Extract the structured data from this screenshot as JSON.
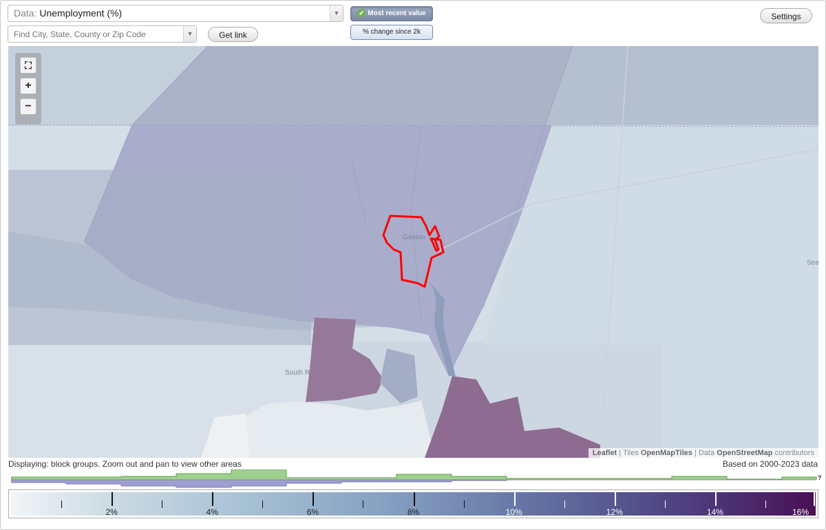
{
  "data_select": {
    "prefix": "Data:",
    "value": "Unemployment (%)"
  },
  "search": {
    "placeholder": "Find City, State, County or Zip Code"
  },
  "buttons": {
    "get_link": "Get link",
    "settings": "Settings"
  },
  "mode_toggle": {
    "active": "Most recent value",
    "inactive": "% change since 2k"
  },
  "zoom": {
    "fullscreen": "⛶",
    "zoom_in": "+",
    "zoom_out": "−"
  },
  "map_labels": {
    "city": "Gaston",
    "town": "South Ro",
    "edge": "Sea"
  },
  "attribution": {
    "leaflet": "Leaflet",
    "tiles_prefix": "| Tiles",
    "tiles": "OpenMapTiles",
    "data_prefix": "| Data",
    "osm": "OpenStreetMap",
    "suffix": "contributors"
  },
  "footer": {
    "displaying": "Displaying: block groups. Zoom out and pan to view other areas",
    "based_on": "Based on 2000-2023 data",
    "help": "?"
  },
  "legend": {
    "min_pct": 0,
    "max_pct": 16,
    "labels": [
      "2%",
      "4%",
      "6%",
      "8%",
      "10%",
      "12%",
      "14%",
      "16%"
    ],
    "colors": {
      "low": "#f1f5f7",
      "mid": "#7f99bd",
      "high": "#4a0f55",
      "selected_outline": "#ff0000",
      "histogram_green": "#9fd08f",
      "histogram_purple": "#9e9ed2"
    }
  }
}
